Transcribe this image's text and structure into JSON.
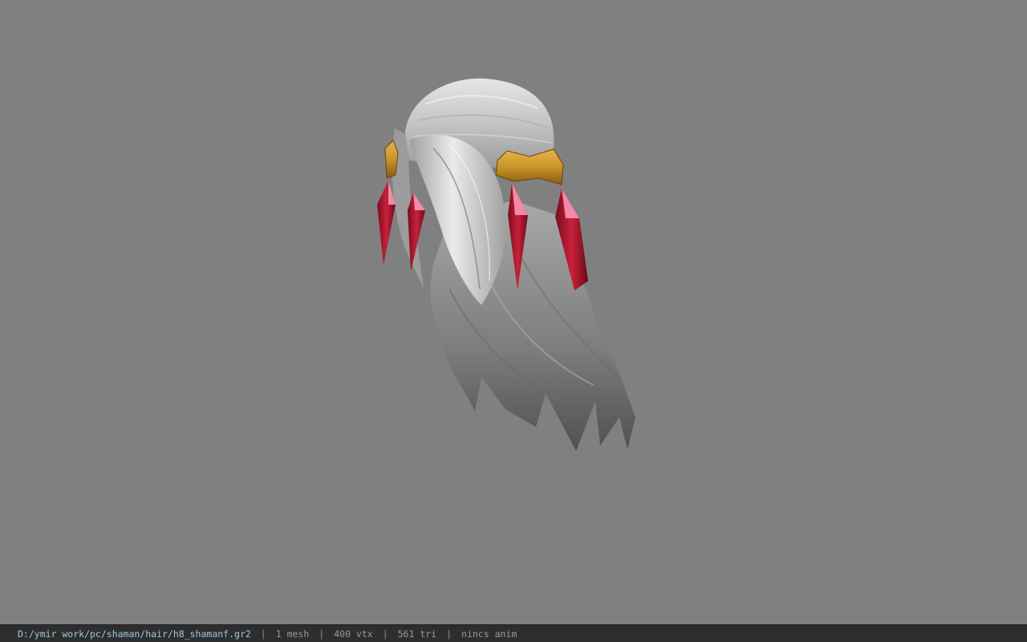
{
  "viewport": {
    "background_color": "#808080",
    "model": {
      "hair_color": "#c8c8c8",
      "band_color": "#c8952a",
      "crystal_color": "#b0182c",
      "crystal_highlight": "#f08aa8"
    }
  },
  "status_bar": {
    "file_path": "D:/ymir work/pc/shaman/hair/h8_shamanf.gr2",
    "separator": "|",
    "mesh_count": "1 mesh",
    "vertex_count": "400 vtx",
    "triangle_count": "561 tri",
    "animation": "nincs anim",
    "path_color": "#9fc8e0",
    "text_color": "#9a9a9a"
  }
}
